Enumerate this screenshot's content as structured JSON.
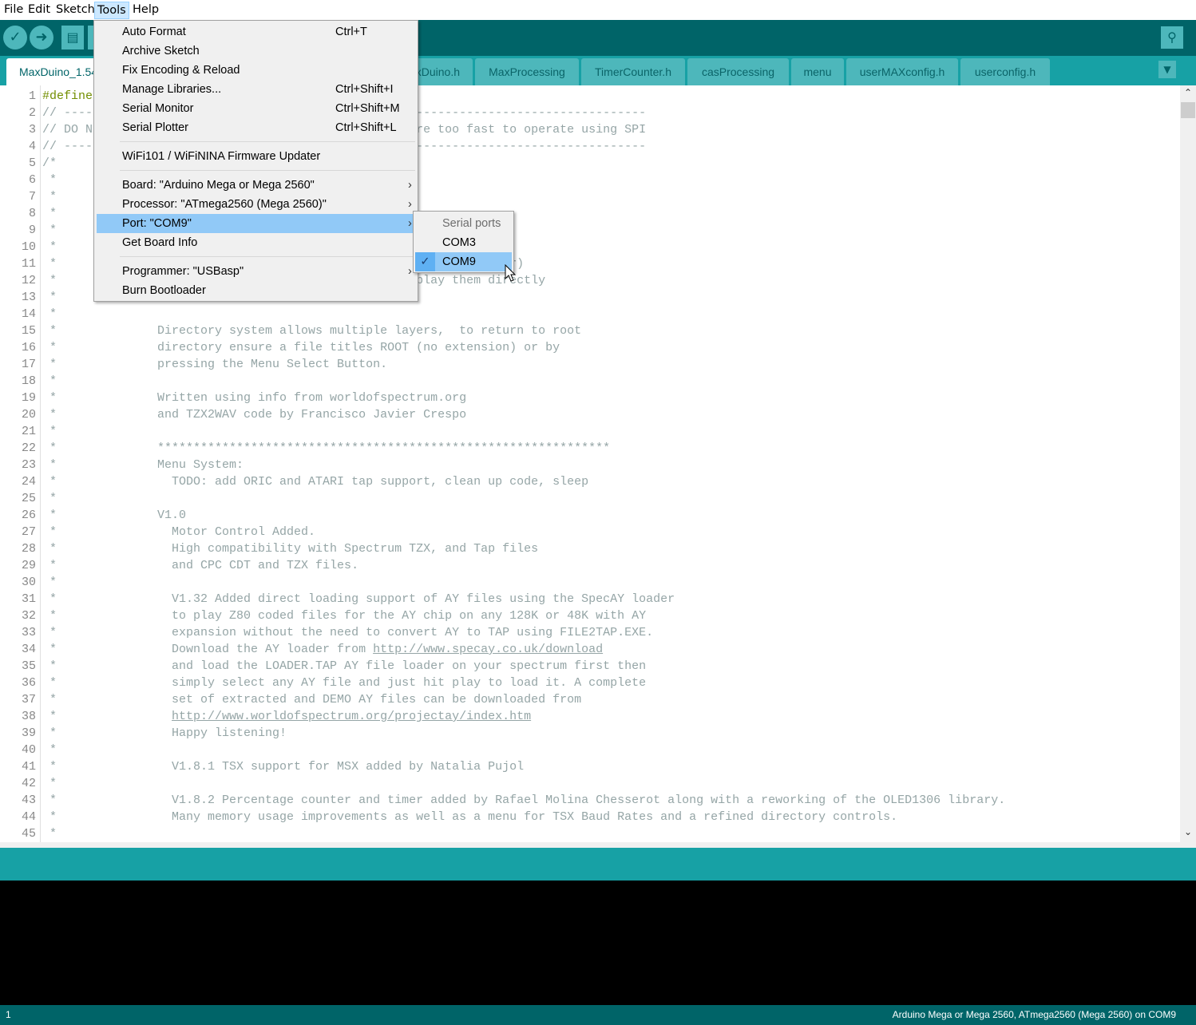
{
  "menubar": {
    "items": [
      "File",
      "Edit",
      "Sketch",
      "Tools",
      "Help"
    ],
    "active": "Tools"
  },
  "toolbar": {
    "verify_icon": "checkmark-icon",
    "upload_icon": "arrow-right-icon",
    "new_icon": "document-icon",
    "serial_monitor_icon": "magnifier-icon"
  },
  "tabs": {
    "items": [
      "MaxDuino_1.54",
      "MaxDuino.h",
      "MaxProcessing",
      "TimerCounter.h",
      "casProcessing",
      "menu",
      "userMAXconfig.h",
      "userconfig.h"
    ],
    "active": "MaxDuino_1.54"
  },
  "editor": {
    "lines": [
      {
        "n": "1",
        "segs": [
          {
            "t": "#define",
            "c": "kw"
          }
        ]
      },
      {
        "n": "2",
        "segs": [
          {
            "t": "// ---------------------------------------------------------------------------------"
          }
        ]
      },
      {
        "n": "3",
        "segs": [
          {
            "t": "// DO N                                             re too fast to operate using SPI"
          }
        ]
      },
      {
        "n": "4",
        "segs": [
          {
            "t": "// ---------------------------------------------------------------------------------"
          }
        ]
      },
      {
        "n": "5",
        "segs": [
          {
            "t": "/*"
          }
        ]
      },
      {
        "n": "6",
        "segs": [
          {
            "t": " *"
          }
        ]
      },
      {
        "n": "7",
        "segs": [
          {
            "t": " *"
          }
        ]
      },
      {
        "n": "8",
        "segs": [
          {
            "t": " *"
          }
        ]
      },
      {
        "n": "9",
        "segs": [
          {
            "t": " *"
          }
        ]
      },
      {
        "n": "10",
        "segs": [
          {
            "t": " *"
          }
        ]
      },
      {
        "n": "11",
        "segs": [
          {
            "t": " *                                                               r)"
          }
        ]
      },
      {
        "n": "12",
        "segs": [
          {
            "t": " *                                                  play them directly"
          }
        ]
      },
      {
        "n": "13",
        "segs": [
          {
            "t": " *"
          }
        ]
      },
      {
        "n": "14",
        "segs": [
          {
            "t": " *"
          }
        ]
      },
      {
        "n": "15",
        "segs": [
          {
            "t": " *              Directory system allows multiple layers,  to return to root"
          }
        ]
      },
      {
        "n": "16",
        "segs": [
          {
            "t": " *              directory ensure a file titles ROOT (no extension) or by"
          }
        ]
      },
      {
        "n": "17",
        "segs": [
          {
            "t": " *              pressing the Menu Select Button."
          }
        ]
      },
      {
        "n": "18",
        "segs": [
          {
            "t": " *"
          }
        ]
      },
      {
        "n": "19",
        "segs": [
          {
            "t": " *              Written using info from worldofspectrum.org"
          }
        ]
      },
      {
        "n": "20",
        "segs": [
          {
            "t": " *              and TZX2WAV code by Francisco Javier Crespo"
          }
        ]
      },
      {
        "n": "21",
        "segs": [
          {
            "t": " *"
          }
        ]
      },
      {
        "n": "22",
        "segs": [
          {
            "t": " *              ***************************************************************"
          }
        ]
      },
      {
        "n": "23",
        "segs": [
          {
            "t": " *              Menu System:"
          }
        ]
      },
      {
        "n": "24",
        "segs": [
          {
            "t": " *                TODO: add ORIC and ATARI tap support, clean up code, sleep"
          }
        ]
      },
      {
        "n": "25",
        "segs": [
          {
            "t": " *"
          }
        ]
      },
      {
        "n": "26",
        "segs": [
          {
            "t": " *              V1.0"
          }
        ]
      },
      {
        "n": "27",
        "segs": [
          {
            "t": " *                Motor Control Added."
          }
        ]
      },
      {
        "n": "28",
        "segs": [
          {
            "t": " *                High compatibility with Spectrum TZX, and Tap files"
          }
        ]
      },
      {
        "n": "29",
        "segs": [
          {
            "t": " *                and CPC CDT and TZX files."
          }
        ]
      },
      {
        "n": "30",
        "segs": [
          {
            "t": " *"
          }
        ]
      },
      {
        "n": "31",
        "segs": [
          {
            "t": " *                V1.32 Added direct loading support of AY files using the SpecAY loader"
          }
        ]
      },
      {
        "n": "32",
        "segs": [
          {
            "t": " *                to play Z80 coded files for the AY chip on any 128K or 48K with AY"
          }
        ]
      },
      {
        "n": "33",
        "segs": [
          {
            "t": " *                expansion without the need to convert AY to TAP using FILE2TAP.EXE."
          }
        ]
      },
      {
        "n": "34",
        "segs": [
          {
            "t": " *                Download the AY loader from "
          },
          {
            "t": "http://www.specay.co.uk/download",
            "c": "url"
          }
        ]
      },
      {
        "n": "35",
        "segs": [
          {
            "t": " *                and load the LOADER.TAP AY file loader on your spectrum first then"
          }
        ]
      },
      {
        "n": "36",
        "segs": [
          {
            "t": " *                simply select any AY file and just hit play to load it. A complete"
          }
        ]
      },
      {
        "n": "37",
        "segs": [
          {
            "t": " *                set of extracted and DEMO AY files can be downloaded from"
          }
        ]
      },
      {
        "n": "38",
        "segs": [
          {
            "t": " *                "
          },
          {
            "t": "http://www.worldofspectrum.org/projectay/index.htm",
            "c": "url"
          }
        ]
      },
      {
        "n": "39",
        "segs": [
          {
            "t": " *                Happy listening!"
          }
        ]
      },
      {
        "n": "40",
        "segs": [
          {
            "t": " *"
          }
        ]
      },
      {
        "n": "41",
        "segs": [
          {
            "t": " *                V1.8.1 TSX support for MSX added by Natalia Pujol"
          }
        ]
      },
      {
        "n": "42",
        "segs": [
          {
            "t": " *"
          }
        ]
      },
      {
        "n": "43",
        "segs": [
          {
            "t": " *                V1.8.2 Percentage counter and timer added by Rafael Molina Chesserot along with a reworking of the OLED1306 library."
          }
        ]
      },
      {
        "n": "44",
        "segs": [
          {
            "t": " *                Many memory usage improvements as well as a menu for TSX Baud Rates and a refined directory controls."
          }
        ]
      },
      {
        "n": "45",
        "segs": [
          {
            "t": " *"
          }
        ]
      }
    ]
  },
  "tools_menu": {
    "items": [
      {
        "label": "Auto Format",
        "shortcut": "Ctrl+T"
      },
      {
        "label": "Archive Sketch",
        "shortcut": ""
      },
      {
        "label": "Fix Encoding & Reload",
        "shortcut": ""
      },
      {
        "label": "Manage Libraries...",
        "shortcut": "Ctrl+Shift+I"
      },
      {
        "label": "Serial Monitor",
        "shortcut": "Ctrl+Shift+M"
      },
      {
        "label": "Serial Plotter",
        "shortcut": "Ctrl+Shift+L"
      },
      {
        "label": "WiFi101 / WiFiNINA Firmware Updater",
        "shortcut": ""
      },
      {
        "label": "Board: \"Arduino Mega or Mega 2560\"",
        "submenu": true
      },
      {
        "label": "Processor: \"ATmega2560 (Mega 2560)\"",
        "submenu": true
      },
      {
        "label": "Port: \"COM9\"",
        "submenu": true,
        "highlighted": true
      },
      {
        "label": "Get Board Info"
      },
      {
        "label": "Programmer: \"USBasp\"",
        "submenu": true
      },
      {
        "label": "Burn Bootloader"
      }
    ]
  },
  "port_submenu": {
    "header": "Serial ports",
    "items": [
      {
        "label": "COM3",
        "checked": false
      },
      {
        "label": "COM9",
        "checked": true
      }
    ]
  },
  "status": {
    "line": "1",
    "board": "Arduino Mega or Mega 2560, ATmega2560 (Mega 2560) on COM9"
  },
  "colors": {
    "toolbar": "#006468",
    "tabbar": "#17a1a5",
    "tab": "#4db7bb",
    "highlight": "#91c9f7",
    "comment": "#95a5a6",
    "keyword": "#728e00"
  }
}
